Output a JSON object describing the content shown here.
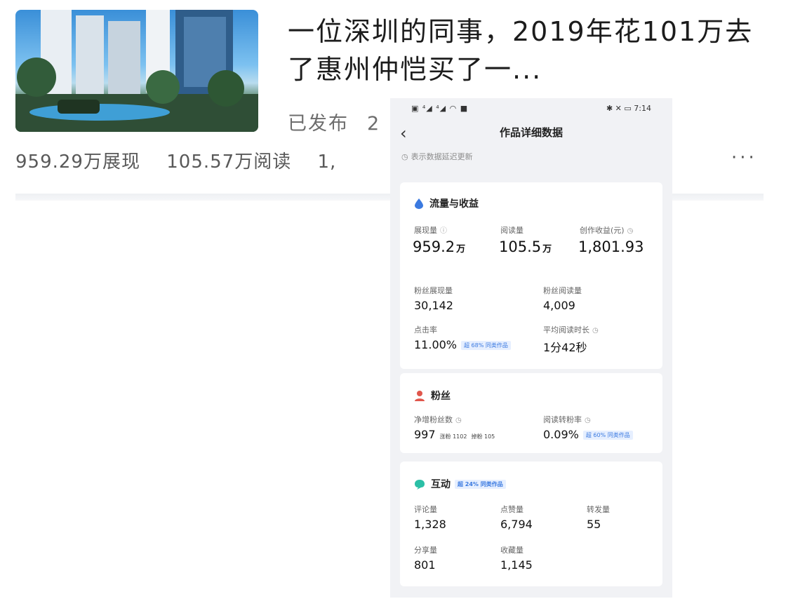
{
  "article": {
    "title": "一位深圳的同事，2019年花101万去了惠州仲恺买了一...",
    "status": "已发布",
    "status_tail": "2",
    "stats": [
      "959.29万展现",
      "105.57万阅读",
      "1,"
    ],
    "more": "···"
  },
  "phone": {
    "status_bar": {
      "left_icons": "▣ ⁴◢ ⁴◢ ◠ ■",
      "right_icons": "✱ ✕ ▭",
      "time": "7:14"
    },
    "nav": {
      "back": "‹",
      "title": "作品详细数据"
    },
    "notice": "表示数据延迟更新",
    "traffic": {
      "title": "流量与收益",
      "impressions_label": "展现量",
      "impressions_value": "959.2",
      "impressions_unit": "万",
      "reads_label": "阅读量",
      "reads_value": "105.5",
      "reads_unit": "万",
      "income_label": "创作收益(元)",
      "income_value": "1,801.93",
      "fan_impr_label": "粉丝展现量",
      "fan_impr_value": "30,142",
      "fan_reads_label": "粉丝阅读量",
      "fan_reads_value": "4,009",
      "ctr_label": "点击率",
      "ctr_value": "11.00%",
      "ctr_tag": "超 68% 同类作品",
      "avg_time_label": "平均阅读时长",
      "avg_time_value": "1分42秒"
    },
    "fans": {
      "title": "粉丝",
      "net_label": "净增粉丝数",
      "net_value": "997",
      "net_follow": "涨粉 1102",
      "net_unfollow": "掉粉 105",
      "conv_label": "阅读转粉率",
      "conv_value": "0.09%",
      "conv_tag": "超 60% 同类作品"
    },
    "interact": {
      "title": "互动",
      "tag": "超 24% 同类作品",
      "comments_label": "评论量",
      "comments_value": "1,328",
      "likes_label": "点赞量",
      "likes_value": "6,794",
      "shares_fw_label": "转发量",
      "shares_fw_value": "55",
      "share_label": "分享量",
      "share_value": "801",
      "fav_label": "收藏量",
      "fav_value": "1,145"
    }
  },
  "colors": {
    "accent_blue": "#3b7ae0",
    "fans_red": "#e0564c",
    "interact_teal": "#2bbfa6"
  }
}
